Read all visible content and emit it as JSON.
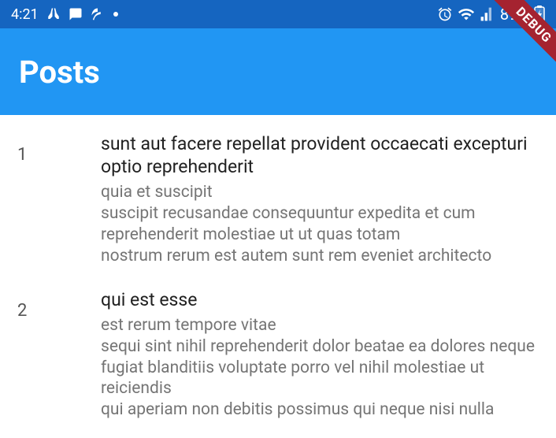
{
  "statusBar": {
    "time": "4:21",
    "batteryPercent": "89%"
  },
  "appBar": {
    "title": "Posts"
  },
  "debugBanner": "DEBUG",
  "posts": [
    {
      "id": "1",
      "title": "sunt aut facere repellat provident occaecati excepturi optio reprehenderit",
      "body": "quia et suscipit\nsuscipit recusandae consequuntur expedita et cum\nreprehenderit molestiae ut ut quas totam\nnostrum rerum est autem sunt rem eveniet architecto"
    },
    {
      "id": "2",
      "title": "qui est esse",
      "body": "est rerum tempore vitae\nsequi sint nihil reprehenderit dolor beatae ea dolores neque\nfugiat blanditiis voluptate porro vel nihil molestiae ut reiciendis\nqui aperiam non debitis possimus qui neque nisi nulla"
    }
  ]
}
